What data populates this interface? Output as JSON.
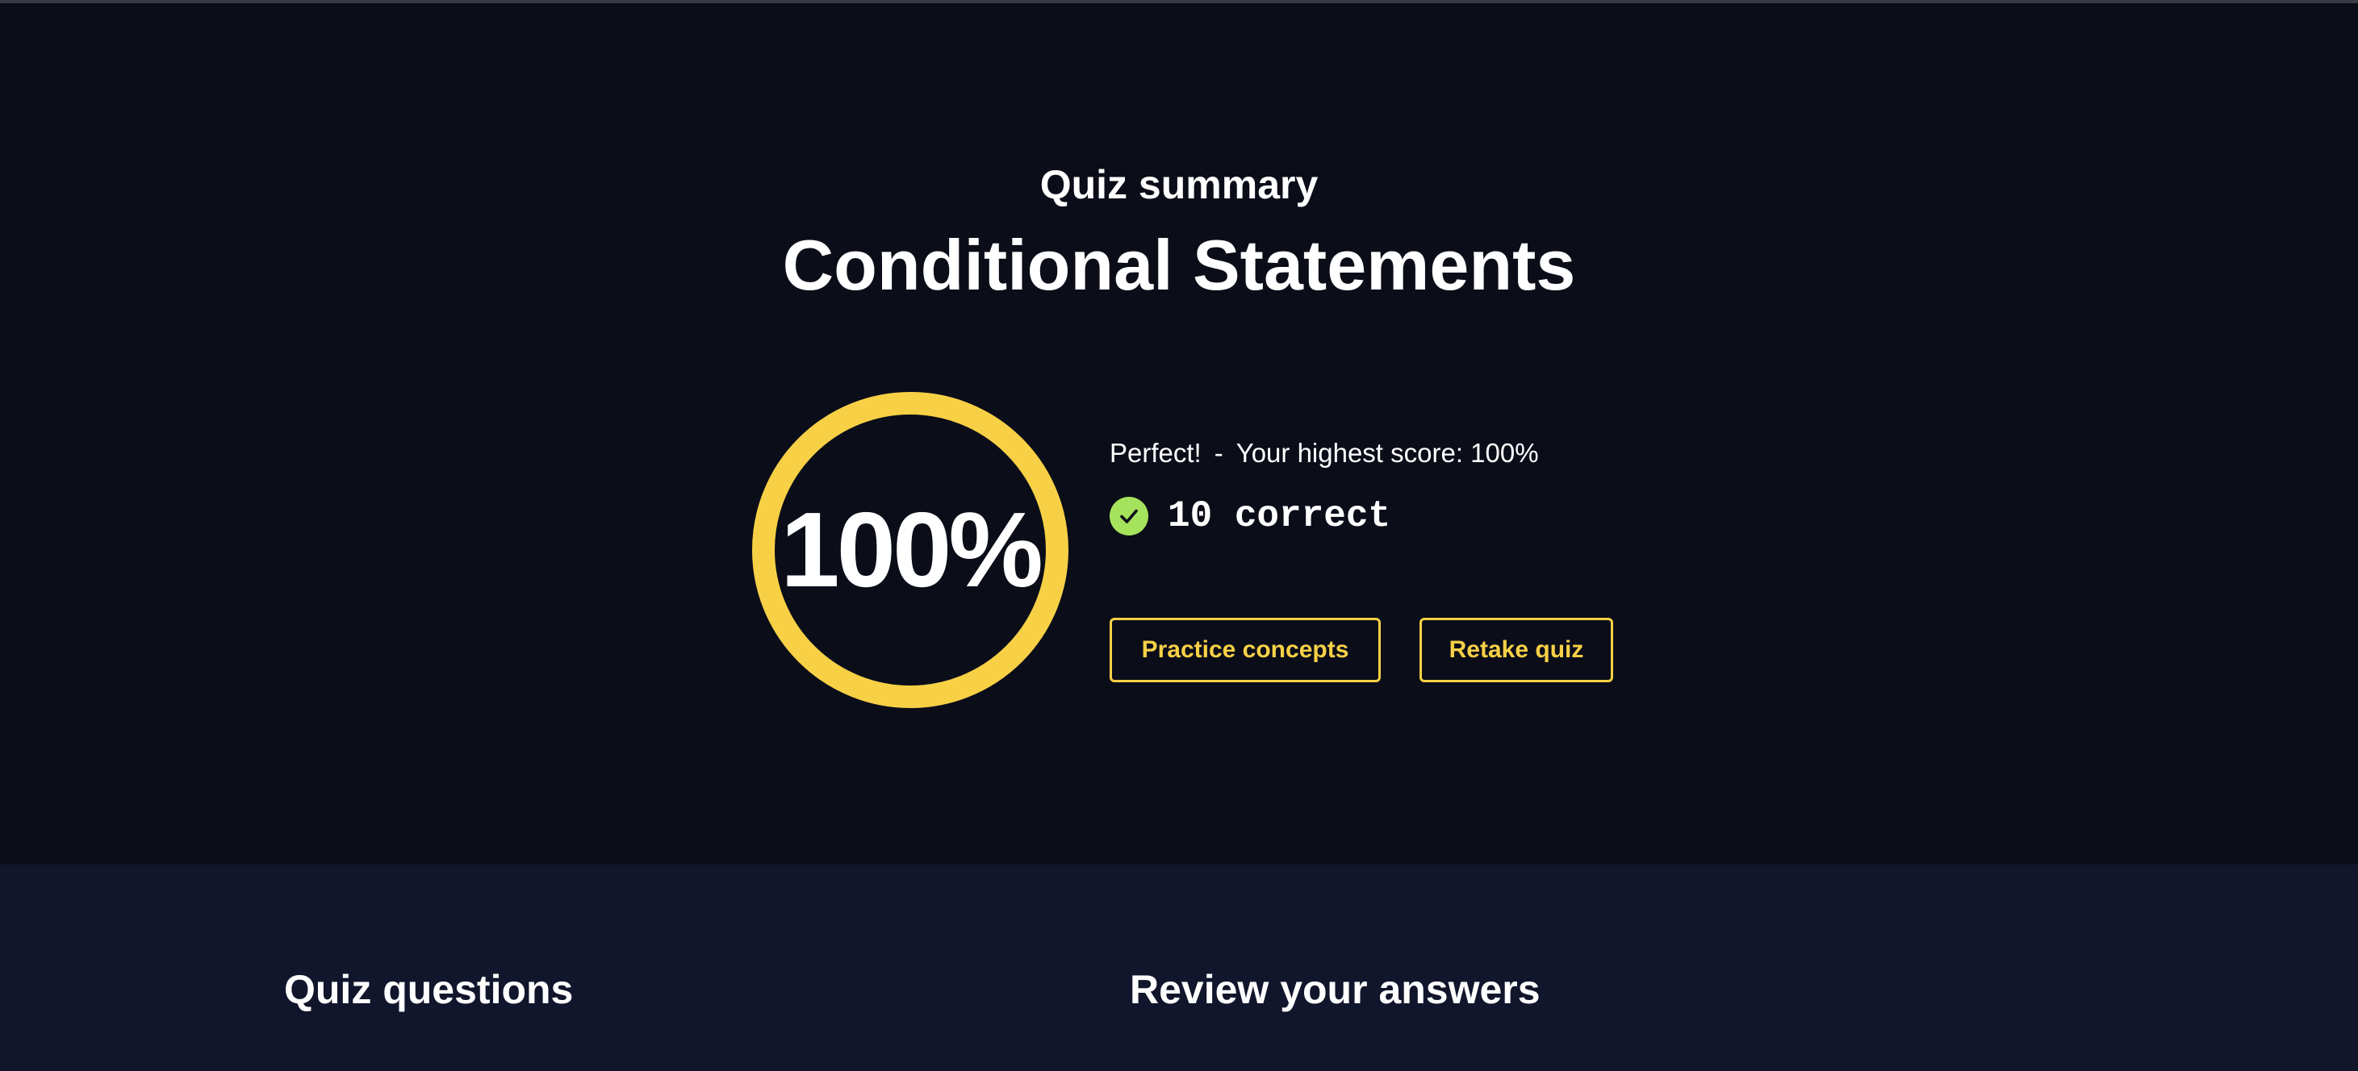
{
  "summary": {
    "subtitle": "Quiz summary",
    "title": "Conditional Statements",
    "score_percent": "100%",
    "score_fraction": 1.0,
    "rating": "Perfect!",
    "separator": "-",
    "highest_score": "Your highest score: 100%",
    "correct_text": "10 correct",
    "practice_label": "Practice concepts",
    "retake_label": "Retake quiz"
  },
  "review": {
    "questions_heading": "Quiz questions",
    "answers_heading": "Review your answers"
  },
  "colors": {
    "background": "#0b0d19",
    "review_background": "#12162c",
    "accent": "#f7d046",
    "success": "#a6e35c",
    "text": "#ffffff"
  },
  "icons": {
    "correct": "check-circle-icon"
  }
}
